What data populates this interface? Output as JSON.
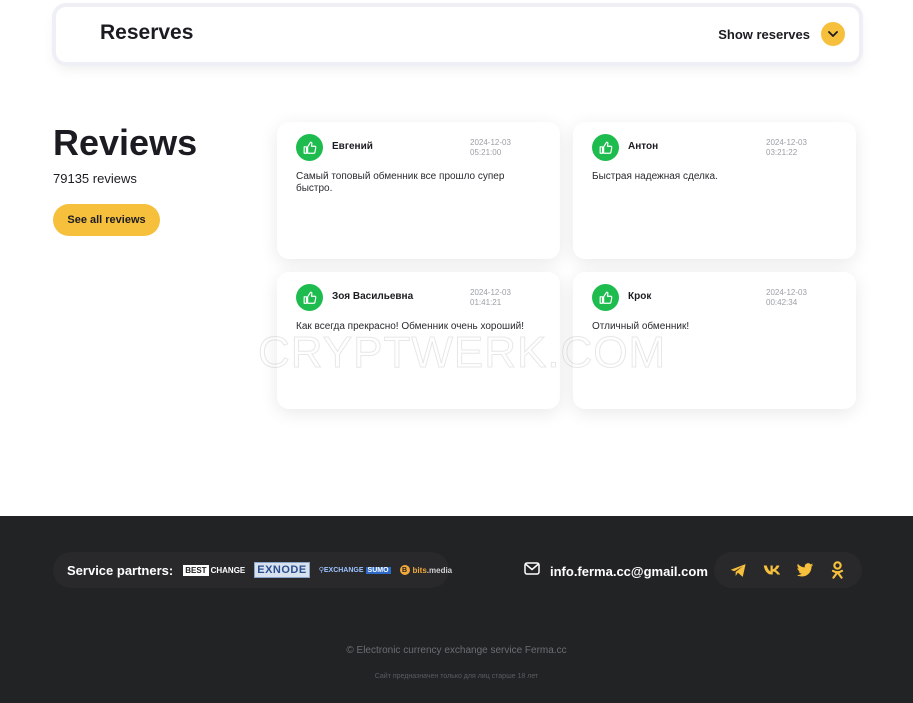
{
  "reserves": {
    "title": "Reserves",
    "toggle_label": "Show reserves"
  },
  "reviews": {
    "title": "Reviews",
    "count_text": "79135 reviews",
    "all_button": "See all reviews",
    "items": [
      {
        "name": "Евгений",
        "date": "2024-12-03",
        "time": "05:21:00",
        "text": "Самый топовый обменник все прошло супер быстро."
      },
      {
        "name": "Антон",
        "date": "2024-12-03",
        "time": "03:21:22",
        "text": "Быстрая надежная сделка."
      },
      {
        "name": "Зоя Васильевна",
        "date": "2024-12-03",
        "time": "01:41:21",
        "text": "Как всегда прекрасно! Обменник очень хороший!"
      },
      {
        "name": "Крок",
        "date": "2024-12-03",
        "time": "00:42:34",
        "text": "Отличный обменник!"
      }
    ]
  },
  "watermark": "CRYPTWERK.COM",
  "footer": {
    "partners_label": "Service partners:",
    "partners": [
      {
        "name": "BESTCHANGE",
        "part1": "BEST",
        "part2": "CHANGE"
      },
      {
        "name": "EXNODE"
      },
      {
        "name": "EXCHANGESUMO",
        "part1": "EXCHANGE",
        "part2": "SUMO"
      },
      {
        "name": "bits.media",
        "part1": "bits",
        "part2": ".media"
      }
    ],
    "email": "info.ferma.cc@gmail.com",
    "socials": [
      "telegram",
      "vk",
      "twitter",
      "odnoklassniki"
    ],
    "copyright": "© Electronic currency exchange service Ferma.cc",
    "age_notice": "Сайт предназначен только для лиц старше 18 лет"
  },
  "colors": {
    "accent": "#f6c03d",
    "like_green": "#1ebc4f",
    "footer_bg": "#222325"
  }
}
